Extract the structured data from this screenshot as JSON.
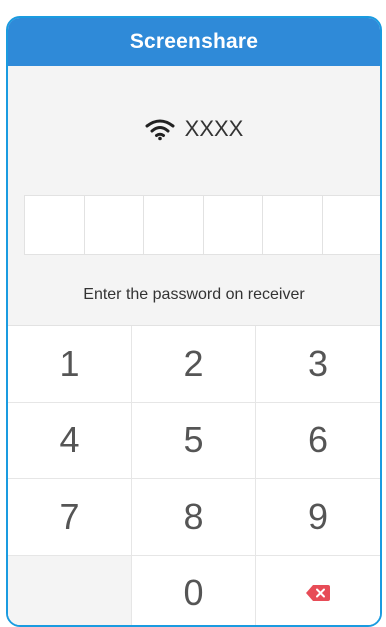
{
  "window": {
    "title": "Screenshare"
  },
  "network": {
    "icon": "wifi-icon",
    "name": "XXXX"
  },
  "password": {
    "box_count": 6,
    "hint": "Enter the password on receiver"
  },
  "keypad": {
    "keys": [
      "1",
      "2",
      "3",
      "4",
      "5",
      "6",
      "7",
      "8",
      "9",
      "",
      "0",
      "backspace"
    ],
    "backspace_color": "#e74c57"
  },
  "colors": {
    "title_bar": "#2f8ad8",
    "frame_border": "#1a9be0",
    "background": "#f4f4f4"
  }
}
